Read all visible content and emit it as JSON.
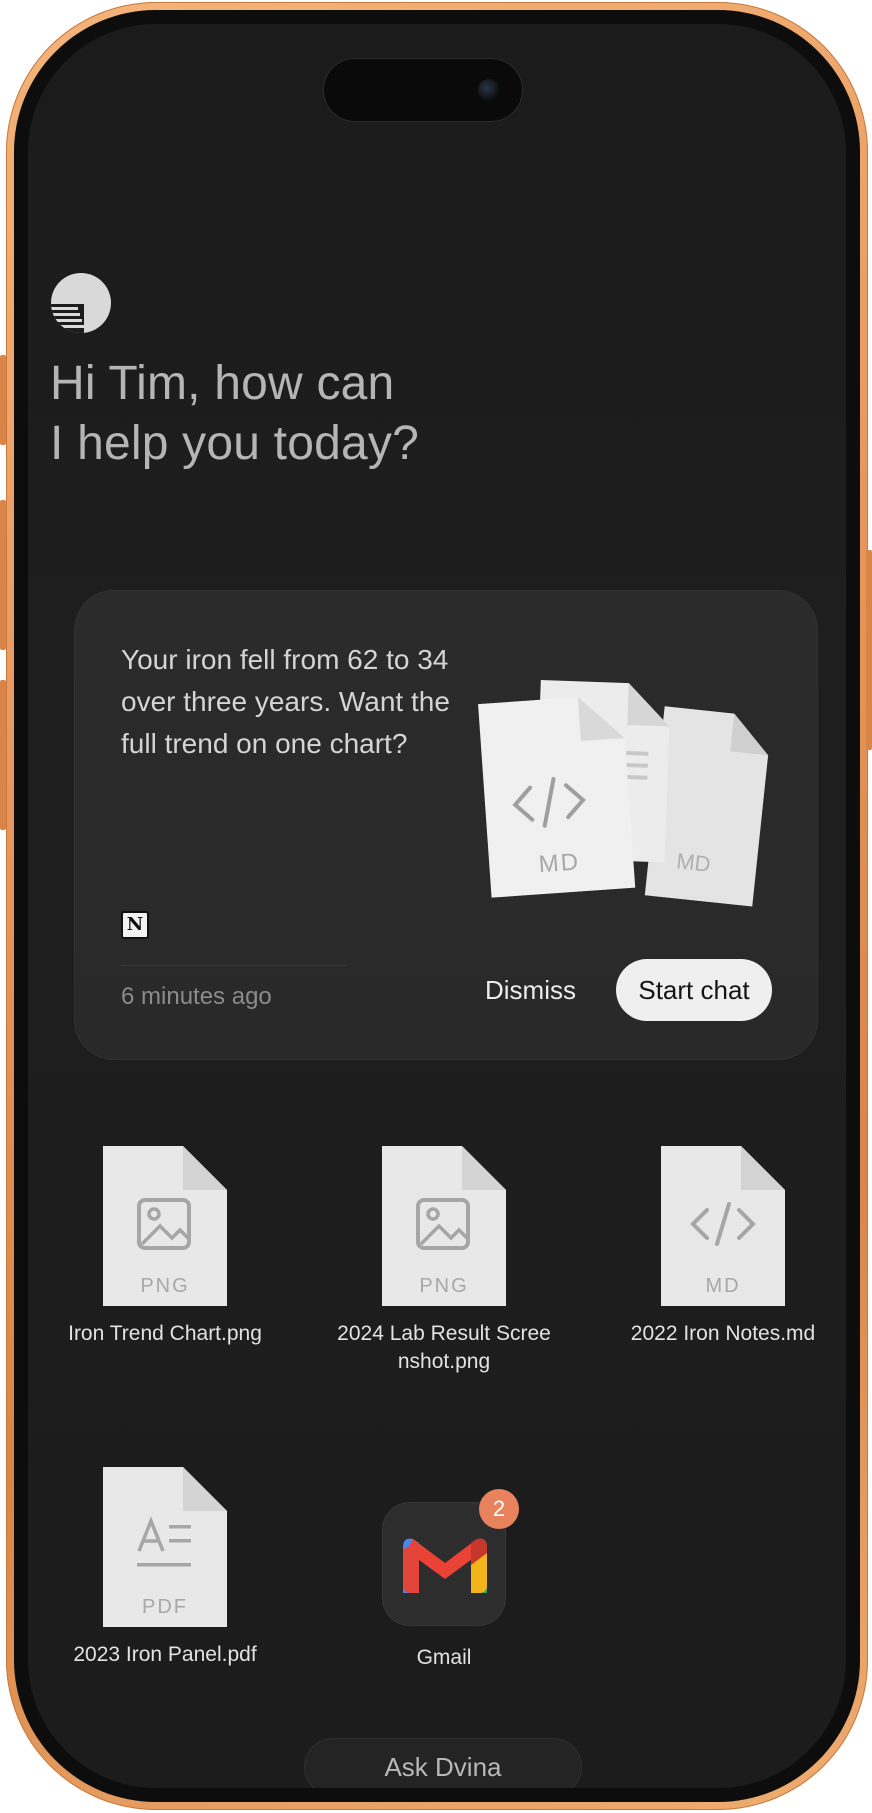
{
  "greeting": {
    "line1": "Hi Tim, how can",
    "line2": "I help you today?"
  },
  "suggestion_card": {
    "message": "Your iron fell from 62 to 34 over three years. Want the full trend on one chart?",
    "source_icon": "notion-icon",
    "timestamp": "6 minutes ago",
    "dismiss_label": "Dismiss",
    "start_chat_label": "Start chat",
    "art_file_type": "MD",
    "art_back_file_type": "MD"
  },
  "files": [
    {
      "name": "Iron Trend Chart.png",
      "type": "PNG",
      "icon": "image-file-icon"
    },
    {
      "name": "2024 Lab Result Screenshot.png",
      "type": "PNG",
      "icon": "image-file-icon"
    },
    {
      "name": "2022 Iron Notes.md",
      "type": "MD",
      "icon": "code-file-icon"
    },
    {
      "name": "2023 Iron Panel.pdf",
      "type": "PDF",
      "icon": "text-file-icon"
    }
  ],
  "apps": [
    {
      "name": "Gmail",
      "badge": "2",
      "icon": "gmail-icon"
    }
  ],
  "ask_bar": {
    "label": "Ask Dvina"
  },
  "colors": {
    "frame": "#e7955a",
    "screen": "#1c1c1c",
    "card": "#2a2a2a",
    "badge": "#e7825c",
    "primary_button": "#efefef"
  }
}
